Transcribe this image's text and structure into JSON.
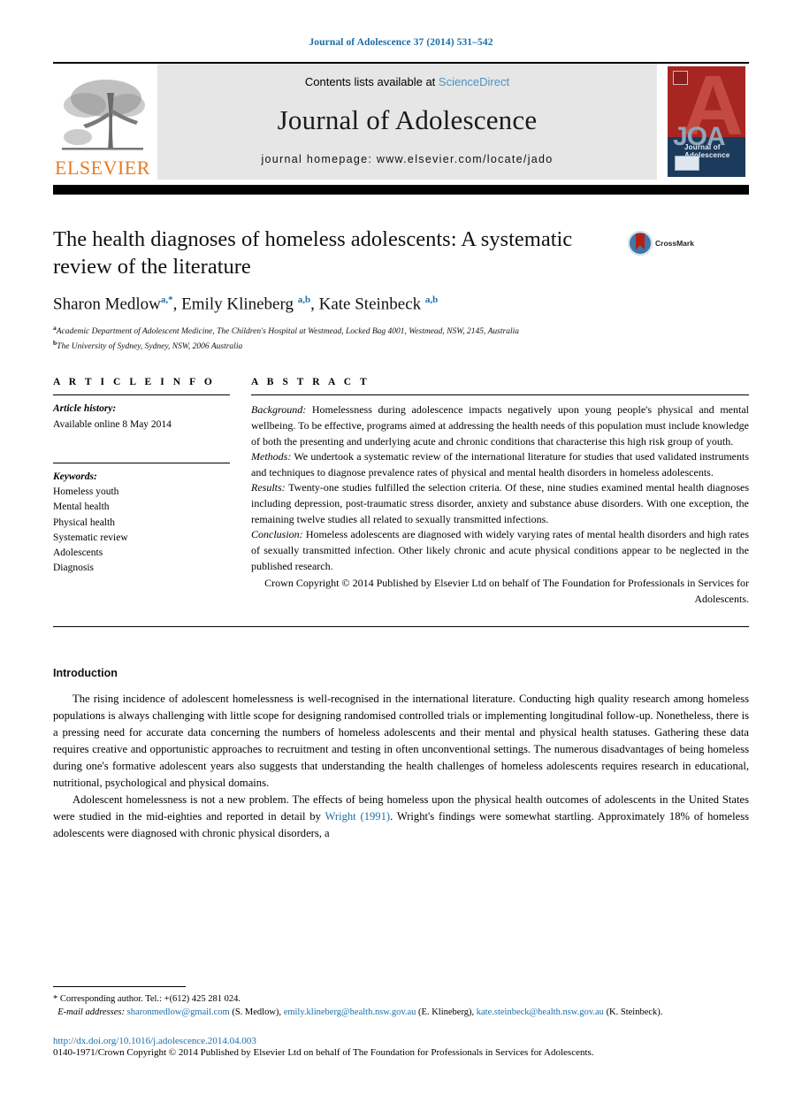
{
  "running_head": "Journal of Adolescence 37 (2014) 531–542",
  "masthead": {
    "publisher_name": "ELSEVIER",
    "contents_prefix": "Contents lists available at ",
    "contents_link": "ScienceDirect",
    "journal_title": "Journal of Adolescence",
    "homepage": "journal homepage: www.elsevier.com/locate/jado",
    "cover": {
      "acronym": "JOA",
      "name": "Journal of Adolescence",
      "letter": "A"
    }
  },
  "article": {
    "title": "The health diagnoses of homeless adolescents: A systematic review of the literature",
    "crossmark_label": "CrossMark",
    "authors_html": "Sharon Medlow<sup>a,&#42;</sup>, Emily Klineberg <sup>a,b</sup>, Kate Steinbeck <sup>a,b</sup>",
    "affiliations": [
      {
        "marker": "a",
        "text": "Academic Department of Adolescent Medicine, The Children's Hospital at Westmead, Locked Bag 4001, Westmead, NSW, 2145, Australia"
      },
      {
        "marker": "b",
        "text": "The University of Sydney, Sydney, NSW, 2006 Australia"
      }
    ]
  },
  "article_info": {
    "heading": "A R T I C L E   I N F O",
    "history_label": "Article history:",
    "history_value": "Available online 8 May 2014",
    "keywords_label": "Keywords:",
    "keywords": [
      "Homeless youth",
      "Mental health",
      "Physical health",
      "Systematic review",
      "Adolescents",
      "Diagnosis"
    ]
  },
  "abstract": {
    "heading": "A B S T R A C T",
    "sections": [
      {
        "label": "Background:",
        "text": " Homelessness during adolescence impacts negatively upon young people's physical and mental wellbeing. To be effective, programs aimed at addressing the health needs of this population must include knowledge of both the presenting and underlying acute and chronic conditions that characterise this high risk group of youth."
      },
      {
        "label": "Methods:",
        "text": " We undertook a systematic review of the international literature for studies that used validated instruments and techniques to diagnose prevalence rates of physical and mental health disorders in homeless adolescents."
      },
      {
        "label": "Results:",
        "text": " Twenty-one studies fulfilled the selection criteria. Of these, nine studies examined mental health diagnoses including depression, post-traumatic stress disorder, anxiety and substance abuse disorders. With one exception, the remaining twelve studies all related to sexually transmitted infections."
      },
      {
        "label": "Conclusion:",
        "text": " Homeless adolescents are diagnosed with widely varying rates of mental health disorders and high rates of sexually transmitted infection. Other likely chronic and acute physical conditions appear to be neglected in the published research."
      }
    ],
    "copyright": "Crown Copyright © 2014 Published by Elsevier Ltd on behalf of The Foundation for Professionals in Services for Adolescents."
  },
  "body": {
    "section_heading": "Introduction",
    "paragraphs": [
      {
        "pre": "The rising incidence of adolescent homelessness is well-recognised in the international literature. Conducting high quality research among homeless populations is always challenging with little scope for designing randomised controlled trials or implementing longitudinal follow-up. Nonetheless, there is a pressing need for accurate data concerning the numbers of homeless adolescents and their mental and physical health statuses. Gathering these data requires creative and opportunistic approaches to recruitment and testing in often unconventional settings. The numerous disadvantages of being homeless during one's formative adolescent years also suggests that understanding the health challenges of homeless adolescents requires research in educational, nutritional, psychological and physical domains.",
        "link": "",
        "post": ""
      },
      {
        "pre": "Adolescent homelessness is not a new problem. The effects of being homeless upon the physical health outcomes of adolescents in the United States were studied in the mid-eighties and reported in detail by ",
        "link": "Wright (1991)",
        "post": ". Wright's findings were somewhat startling. Approximately 18% of homeless adolescents were diagnosed with chronic physical disorders, a"
      }
    ]
  },
  "footnotes": {
    "corresponding": "* Corresponding author. Tel.: +(612) 425 281 024.",
    "email_label": "E-mail addresses:",
    "emails": [
      {
        "address": "sharonmedlow@gmail.com",
        "owner": " (S. Medlow), "
      },
      {
        "address": "emily.klineberg@health.nsw.gov.au",
        "owner": " (E. Klineberg), "
      },
      {
        "address": "kate.steinbeck@health.nsw.gov.au",
        "owner": " (K. Steinbeck)."
      }
    ],
    "doi": "http://dx.doi.org/10.1016/j.adolescence.2014.04.003",
    "issn_line": "0140-1971/Crown Copyright © 2014 Published by Elsevier Ltd on behalf of The Foundation for Professionals in Services for Adolescents."
  },
  "colors": {
    "link_blue": "#1a6ea8",
    "sciencedirect_blue": "#4a93c4",
    "elsevier_orange": "#E87B22",
    "cover_red": "#a72622",
    "cover_navy": "#1b3a5c",
    "banner_gray": "#e6e6e6"
  }
}
